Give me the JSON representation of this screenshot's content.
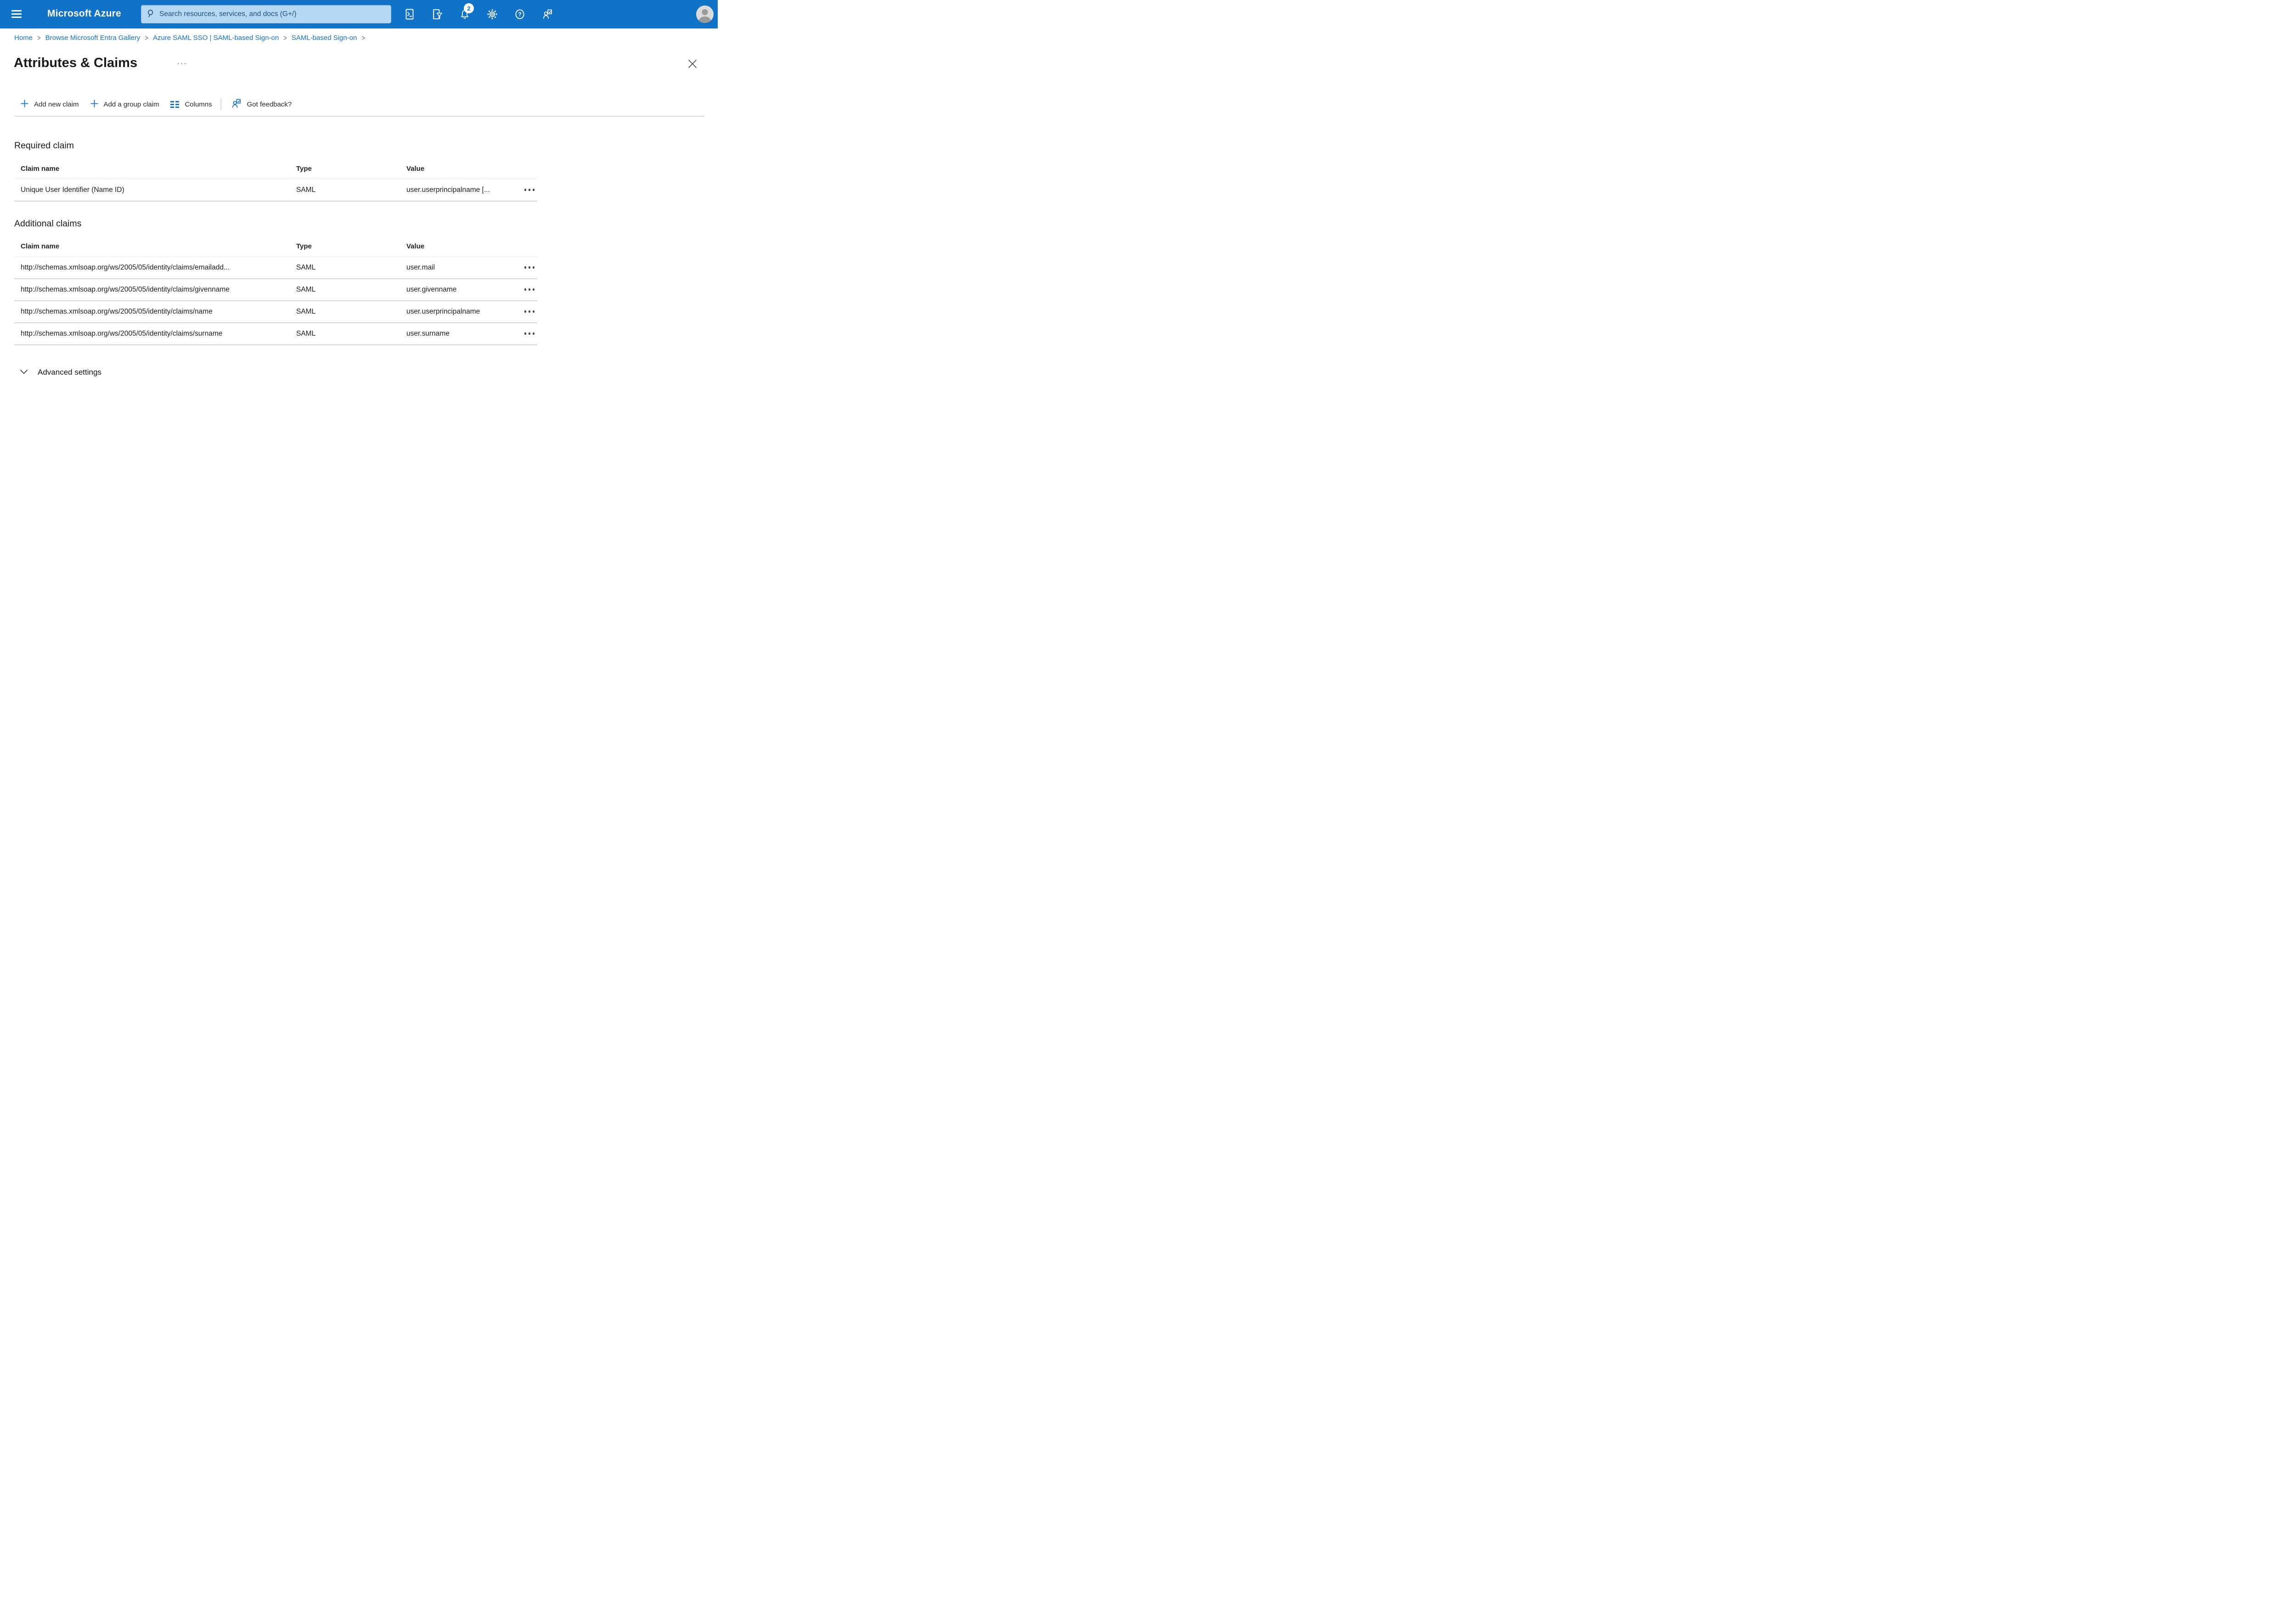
{
  "topbar": {
    "brand": "Microsoft Azure",
    "search_placeholder": "Search resources, services, and docs (G+/)",
    "notification_count": "2",
    "icons": [
      "hamburger-icon",
      "search-icon",
      "cloud-shell-icon",
      "directory-filter-icon",
      "notifications-bell-icon",
      "settings-gear-icon",
      "help-icon",
      "feedback-icon",
      "avatar"
    ]
  },
  "breadcrumb": {
    "separator": ">",
    "items": [
      "Home",
      "Browse Microsoft Entra Gallery",
      "Azure SAML SSO | SAML-based Sign-on",
      "SAML-based Sign-on"
    ]
  },
  "page": {
    "title": "Attributes & Claims",
    "ellipsis": "···"
  },
  "toolbar": {
    "add_new_claim": "Add new claim",
    "add_group_claim": "Add a group claim",
    "columns": "Columns",
    "got_feedback": "Got feedback?"
  },
  "required_claim": {
    "heading": "Required claim",
    "columns": {
      "name": "Claim name",
      "type": "Type",
      "value": "Value"
    },
    "row": {
      "name": "Unique User Identifier (Name ID)",
      "type": "SAML",
      "value": "user.userprincipalname [..."
    }
  },
  "additional_claims": {
    "heading": "Additional claims",
    "columns": {
      "name": "Claim name",
      "type": "Type",
      "value": "Value"
    },
    "rows": [
      {
        "name": "http://schemas.xmlsoap.org/ws/2005/05/identity/claims/emailadd...",
        "type": "SAML",
        "value": "user.mail"
      },
      {
        "name": "http://schemas.xmlsoap.org/ws/2005/05/identity/claims/givenname",
        "type": "SAML",
        "value": "user.givenname"
      },
      {
        "name": "http://schemas.xmlsoap.org/ws/2005/05/identity/claims/name",
        "type": "SAML",
        "value": "user.userprincipalname"
      },
      {
        "name": "http://schemas.xmlsoap.org/ws/2005/05/identity/claims/surname",
        "type": "SAML",
        "value": "user.surname"
      }
    ]
  },
  "advanced": {
    "label": "Advanced settings"
  },
  "colors": {
    "topbar_bg": "#1173C8",
    "search_bg": "#B6D8F2",
    "search_text": "#1C4F82",
    "link_blue": "#1573CE",
    "accent_blue": "#1573CE",
    "text_dark": "#1F1E1D",
    "divider_light": "#E8E8E8",
    "divider": "#D6D6D6",
    "white": "#FFFFFF"
  }
}
